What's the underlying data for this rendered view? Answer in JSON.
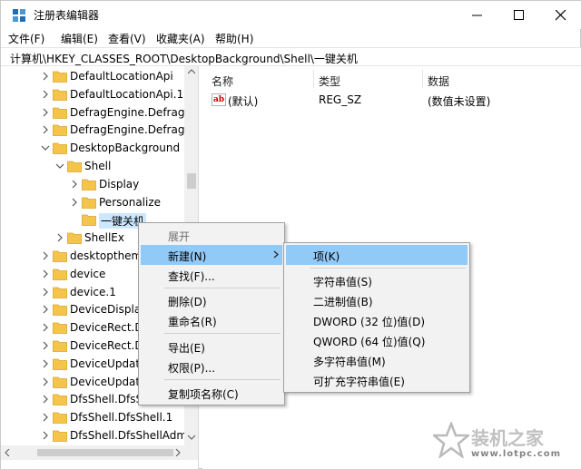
{
  "window": {
    "title": "注册表编辑器"
  },
  "menu": [
    "文件(F)",
    "编辑(E)",
    "查看(V)",
    "收藏夹(A)",
    "帮助(H)"
  ],
  "address": "计算机\\HKEY_CLASSES_ROOT\\DesktopBackground\\Shell\\一键关机",
  "tree": [
    {
      "label": "DefaultLocationApi",
      "expander": "collapsed",
      "indent": 0
    },
    {
      "label": "DefaultLocationApi.1",
      "expander": "collapsed",
      "indent": 0
    },
    {
      "label": "DefragEngine.DefragE",
      "expander": "collapsed",
      "indent": 0
    },
    {
      "label": "DefragEngine.DefragE",
      "expander": "collapsed",
      "indent": 0
    },
    {
      "label": "DesktopBackground",
      "expander": "expanded",
      "indent": 0
    },
    {
      "label": "Shell",
      "expander": "expanded",
      "indent": 1
    },
    {
      "label": "Display",
      "expander": "collapsed",
      "indent": 2
    },
    {
      "label": "Personalize",
      "expander": "collapsed",
      "indent": 2
    },
    {
      "label": "一键关机",
      "expander": "none",
      "indent": 2,
      "selected": true
    },
    {
      "label": "ShellEx",
      "expander": "collapsed",
      "indent": 1
    },
    {
      "label": "desktopthem",
      "expander": "collapsed",
      "indent": 0
    },
    {
      "label": "device",
      "expander": "collapsed",
      "indent": 0
    },
    {
      "label": "device.1",
      "expander": "collapsed",
      "indent": 0
    },
    {
      "label": "DeviceDisplay",
      "expander": "collapsed",
      "indent": 0
    },
    {
      "label": "DeviceRect.D",
      "expander": "collapsed",
      "indent": 0
    },
    {
      "label": "DeviceRect.D",
      "expander": "collapsed",
      "indent": 0
    },
    {
      "label": "DeviceUpdat",
      "expander": "collapsed",
      "indent": 0
    },
    {
      "label": "DeviceUpdat",
      "expander": "collapsed",
      "indent": 0
    },
    {
      "label": "DfsShell.DfsS",
      "expander": "collapsed",
      "indent": 0
    },
    {
      "label": "DfsShell.DfsShell.1",
      "expander": "collapsed",
      "indent": 0
    },
    {
      "label": "DfsShell.DfsShellAdmi",
      "expander": "collapsed",
      "indent": 0
    }
  ],
  "columns": {
    "name": "名称",
    "type": "类型",
    "data": "数据"
  },
  "values": [
    {
      "name": "(默认)",
      "type": "REG_SZ",
      "data": "(数值未设置)",
      "icon": "ab"
    }
  ],
  "context_menu": {
    "items": [
      {
        "label": "展开",
        "state": "disabled"
      },
      {
        "label": "新建(N)",
        "state": "highlighted",
        "submenu": true
      },
      {
        "label": "查找(F)...",
        "state": "normal"
      },
      {
        "label": "删除(D)",
        "state": "normal"
      },
      {
        "label": "重命名(R)",
        "state": "normal"
      },
      {
        "label": "导出(E)",
        "state": "normal"
      },
      {
        "label": "权限(P)...",
        "state": "normal"
      },
      {
        "label": "复制项名称(C)",
        "state": "normal"
      }
    ]
  },
  "new_submenu": {
    "items": [
      {
        "label": "项(K)",
        "state": "highlighted"
      },
      {
        "label": "字符串值(S)",
        "state": "normal"
      },
      {
        "label": "二进制值(B)",
        "state": "normal"
      },
      {
        "label": "DWORD (32 位)值(D)",
        "state": "normal"
      },
      {
        "label": "QWORD (64 位)值(Q)",
        "state": "normal"
      },
      {
        "label": "多字符串值(M)",
        "state": "normal"
      },
      {
        "label": "可扩充字符串值(E)",
        "state": "normal"
      }
    ]
  },
  "watermark": {
    "brand": "装机之家",
    "url": "www.lotpc.com"
  },
  "colors": {
    "highlight": "#91c9f7",
    "selection": "#cce8ff",
    "folder": "#f5c44b",
    "menu_bg": "#f2f2f2"
  }
}
